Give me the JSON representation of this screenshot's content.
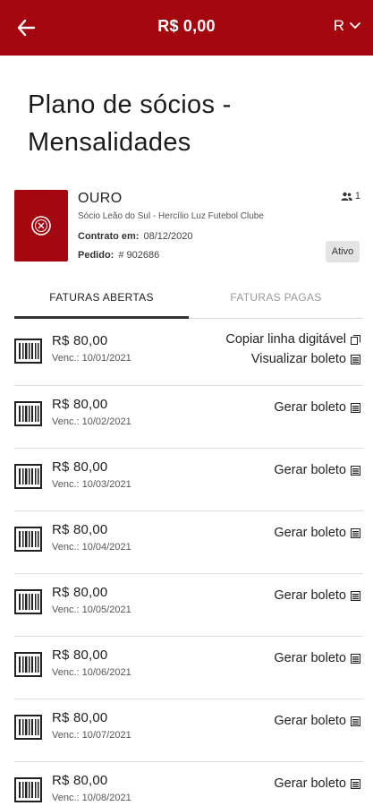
{
  "header": {
    "back_icon": "arrow-left-icon",
    "balance": "R$ 0,00",
    "user_initial": "R",
    "dropdown_icon": "chevron-down-icon",
    "background_color": "#a3060f"
  },
  "page": {
    "title": "Plano de sócios - Mensalidades"
  },
  "plan": {
    "name": "OURO",
    "club": "Sócio Leão do Sul - Hercílio Luz Futebol Clube",
    "contract_label": "Contrato em:",
    "contract_date": "08/12/2020",
    "order_label": "Pedido:",
    "order_number": "# 902686",
    "members_icon": "users-icon",
    "members_count": "1",
    "status": "Ativo"
  },
  "tabs": [
    {
      "label": "FATURAS ABERTAS",
      "active": true
    },
    {
      "label": "FATURAS PAGAS",
      "active": false
    }
  ],
  "invoices": [
    {
      "amount": "R$ 80,00",
      "due": "Venc.: 10/01/2021",
      "actions": [
        "Copiar linha digitável",
        "Visualizar boleto"
      ]
    },
    {
      "amount": "R$ 80,00",
      "due": "Venc.: 10/02/2021",
      "actions": [
        "Gerar boleto"
      ]
    },
    {
      "amount": "R$ 80,00",
      "due": "Venc.: 10/03/2021",
      "actions": [
        "Gerar boleto"
      ]
    },
    {
      "amount": "R$ 80,00",
      "due": "Venc.: 10/04/2021",
      "actions": [
        "Gerar boleto"
      ]
    },
    {
      "amount": "R$ 80,00",
      "due": "Venc.: 10/05/2021",
      "actions": [
        "Gerar boleto"
      ]
    },
    {
      "amount": "R$ 80,00",
      "due": "Venc.: 10/06/2021",
      "actions": [
        "Gerar boleto"
      ]
    },
    {
      "amount": "R$ 80,00",
      "due": "Venc.: 10/07/2021",
      "actions": [
        "Gerar boleto"
      ]
    },
    {
      "amount": "R$ 80,00",
      "due": "Venc.: 10/08/2021",
      "actions": [
        "Gerar boleto"
      ]
    }
  ]
}
